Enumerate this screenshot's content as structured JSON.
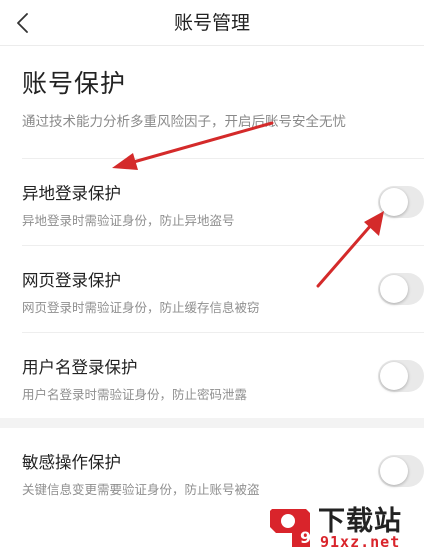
{
  "nav": {
    "title": "账号管理",
    "back_icon": "chevron-left-icon"
  },
  "section": {
    "title": "账号保护",
    "description": "通过技术能力分析多重风险因子，开启后账号安全无忧"
  },
  "items": [
    {
      "label": "异地登录保护",
      "desc": "异地登录时需验证身份，防止异地盗号",
      "enabled": false
    },
    {
      "label": "网页登录保护",
      "desc": "网页登录时需验证身份，防止缓存信息被窃",
      "enabled": false
    },
    {
      "label": "用户名登录保护",
      "desc": "用户名登录时需验证身份，防止密码泄露",
      "enabled": false
    },
    {
      "label": "敏感操作保护",
      "desc": "关键信息变更需要验证身份，防止账号被盗",
      "enabled": false
    }
  ],
  "annotations": {
    "arrow_color": "#d42a2a"
  },
  "watermark": {
    "logo_text": "9",
    "top": "下载站",
    "bottom": "91xz.net",
    "accent": "#d9242b"
  }
}
